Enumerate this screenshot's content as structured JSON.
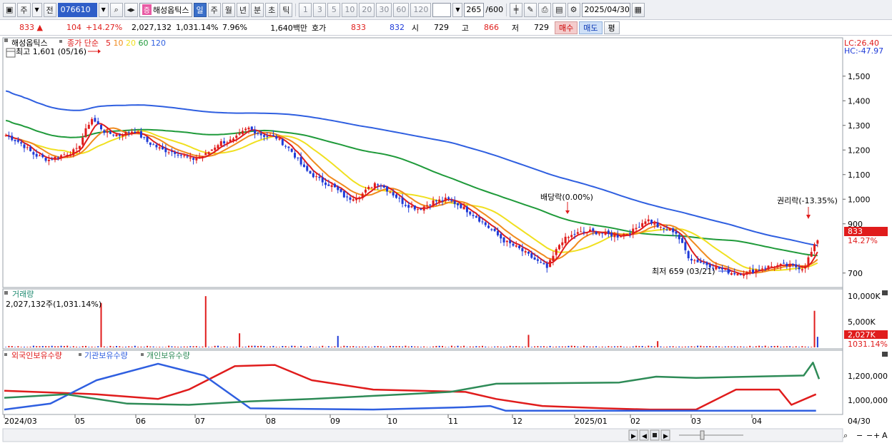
{
  "toolbar": {
    "mode_label": "주",
    "jeon_label": "전",
    "stock_code": "076610",
    "stock_badge": "증",
    "stock_name": "해성옵틱스",
    "period_tabs": [
      "일",
      "주",
      "월",
      "년",
      "분",
      "초",
      "틱"
    ],
    "active_period": "일",
    "interval_buttons": [
      "1",
      "3",
      "5",
      "10",
      "20",
      "30",
      "60",
      "120"
    ],
    "count_value": "265",
    "count_total": "/600",
    "date_value": "2025/04/30"
  },
  "quote": {
    "price": "833",
    "change_arrow": "▲",
    "change": "104",
    "change_pct": "+14.27%",
    "volume": "2,027,132",
    "volume_pct": "1,031.14%",
    "turnover": "7.96%",
    "trade_value": "1,640백만",
    "hoga_label": "호가",
    "ask": "833",
    "bid": "832",
    "open_label": "시",
    "open": "729",
    "high_label": "고",
    "high": "866",
    "low_label": "저",
    "low": "729",
    "buy_button": "매수",
    "sell_button": "매도",
    "eval_button": "평"
  },
  "legend": {
    "name": "해성옵틱스",
    "series_label": "종가 단순",
    "ma": [
      {
        "label": "5",
        "color": "#e01c1c"
      },
      {
        "label": "10",
        "color": "#f08a1e"
      },
      {
        "label": "20",
        "color": "#f0e020"
      },
      {
        "label": "60",
        "color": "#1f9a3a"
      },
      {
        "label": "120",
        "color": "#2f5fe0"
      }
    ],
    "lc": "LC:26.40",
    "hc": "HC:-47.97"
  },
  "annotations": {
    "high_marker": "최고 1,601 (05/16)",
    "low_marker": "최저 659 (03/21)",
    "dividend": "배당락(0.00%)",
    "rights": "권리락(-13.35%)",
    "price_tag": "833",
    "pct_tag": "14.27%"
  },
  "price_axis": [
    "1,500",
    "1,400",
    "1,300",
    "1,200",
    "1,100",
    "1,000",
    "900",
    "700"
  ],
  "volume_panel": {
    "title": "거래량",
    "info": "2,027,132주(1,031.14%)",
    "axis": [
      "10,000K",
      "5,000K"
    ],
    "tag": "2,027K",
    "tag_pct": "1031.14%"
  },
  "holdings_panel": {
    "legend": [
      {
        "label": "외국인보유수량",
        "color": "#e01c1c"
      },
      {
        "label": "기관보유수량",
        "color": "#2f5fe0"
      },
      {
        "label": "개인보유수량",
        "color": "#2e8b57"
      }
    ],
    "axis": [
      "1,200,000",
      "1,000,000"
    ]
  },
  "date_axis": [
    "2024/03",
    "05",
    "06",
    "07",
    "08",
    "09",
    "10",
    "11",
    "12",
    "2025/01",
    "02",
    "03",
    "04"
  ],
  "date_corner": "04/30",
  "colors": {
    "up": "#e01c1c",
    "down": "#1f3bd8",
    "ma120": "#2f5fe0",
    "ma60": "#1f9a3a",
    "ma20": "#f0e020",
    "ma10": "#f08a1e",
    "ma5": "#e01c1c"
  },
  "chart_data": {
    "type": "candlestick",
    "price_range": [
      650,
      1650
    ],
    "series": [
      {
        "name": "해성옵틱스",
        "note": "daily candles, approx. closes",
        "values": [
          1260,
          1230,
          1180,
          1160,
          1180,
          1200,
          1330,
          1270,
          1260,
          1280,
          1230,
          1200,
          1190,
          1160,
          1180,
          1230,
          1240,
          1290,
          1260,
          1250,
          1200,
          1120,
          1080,
          1050,
          1000,
          1020,
          1070,
          1030,
          980,
          960,
          990,
          1000,
          970,
          930,
          880,
          830,
          800,
          760,
          720,
          830,
          860,
          870,
          860,
          850,
          870,
          920,
          880,
          870,
          760,
          740,
          720,
          700,
          700,
          720,
          730,
          730,
          720,
          833
        ]
      }
    ],
    "volume_peaks_k": [
      {
        "date": "05/16",
        "value": 8500
      },
      {
        "date": "07",
        "value": 9800
      },
      {
        "date": "04/30",
        "value": 2027
      }
    ],
    "y_axis_ticks": [
      700,
      900,
      1000,
      1100,
      1200,
      1300,
      1400,
      1500
    ]
  }
}
